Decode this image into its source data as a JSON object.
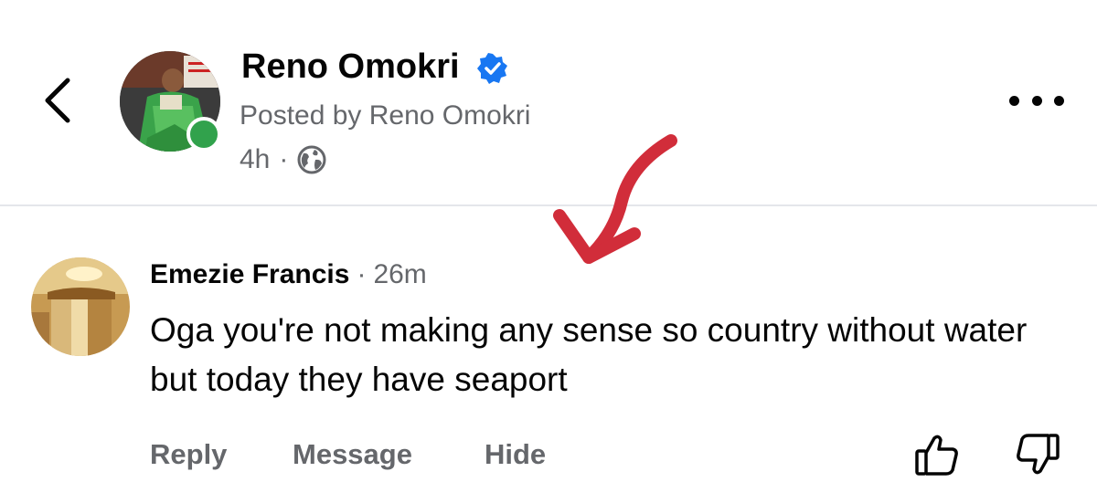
{
  "post_header": {
    "author_name": "Reno Omokri",
    "posted_by": "Posted by Reno Omokri",
    "time": "4h",
    "separator": "·",
    "privacy_icon": "globe-icon"
  },
  "comment": {
    "author_name": "Emezie Francis",
    "separator": "·",
    "time": "26m",
    "text": "Oga you're not making any sense so country without water but today they have seaport"
  },
  "actions": {
    "reply": "Reply",
    "message": "Message",
    "hide": "Hide"
  },
  "colors": {
    "verified_badge": "#1877f2",
    "online_status": "#31a24c",
    "annotation_arrow": "#d12d3a",
    "secondary_text": "#65676b"
  }
}
